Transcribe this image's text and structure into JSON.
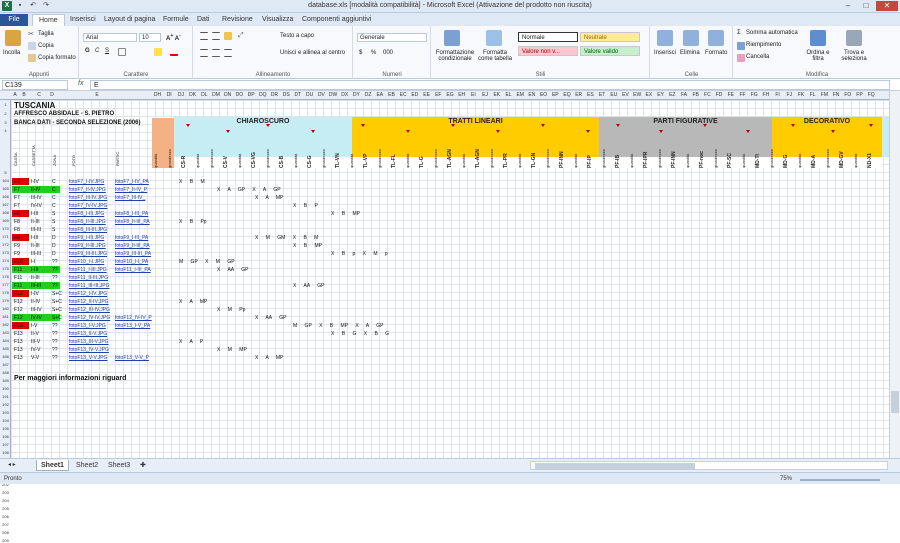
{
  "window": {
    "title": "database.xls [modalità compatibilità] - Microsoft Excel (Attivazione del prodotto non riuscita)",
    "excel_icon": "X"
  },
  "tabs": [
    "File",
    "Home",
    "Inserisci",
    "Layout di pagina",
    "Formule",
    "Dati",
    "Revisione",
    "Visualizza",
    "Componenti aggiuntivi"
  ],
  "ribbon": {
    "clipboard": {
      "paste": "Incolla",
      "cut": "Taglia",
      "copy": "Copia",
      "format_painter": "Copia formato",
      "label": "Appunti"
    },
    "font": {
      "name": "Arial",
      "size": "10",
      "label": "Carattere",
      "bold": "G",
      "italic": "C",
      "underline": "S"
    },
    "alignment": {
      "wrap": "Testo a capo",
      "merge": "Unisci e allinea al centro",
      "label": "Allineamento"
    },
    "number": {
      "format": "Generale",
      "label": "Numeri",
      "currency": "$",
      "percent": "%",
      "thousands": "000"
    },
    "styles": {
      "cond": "Formattazione condizionale",
      "table": "Formatta come tabella",
      "normal": "Normale",
      "neutral": "Neutrale",
      "bad": "Valore non v...",
      "good": "Valore valido",
      "label": "Stili"
    },
    "cells": {
      "insert": "Inserisci",
      "delete": "Elimina",
      "format": "Formato",
      "label": "Celle"
    },
    "editing": {
      "autosum": "Somma automatica",
      "fill": "Riempimento",
      "clear": "Cancella",
      "sort": "Ordina e filtra",
      "find": "Trova e seleziona",
      "label": "Modifica"
    }
  },
  "formula_bar": {
    "name_box": "C139",
    "fx": "fx",
    "value": "E"
  },
  "sheet": {
    "title": "TUSCANIA",
    "subtitle": "AFFRESCO ABSIDALE - S. PIETRO",
    "subtitle2": "BANCA DATI - SECONDA SELEZIONE (2006)",
    "col_titles": [
      "CASSA",
      "CASSETTA",
      "ZONA",
      "FOTO",
      "PARTIC."
    ],
    "sections": [
      "CHIAROSCURO",
      "TRATTI LINEARI",
      "PARTI FIGURATIVE",
      "DECORATIVO"
    ],
    "footer_note": "Per maggiori informazioni riguard",
    "rows": [
      {
        "n": "164",
        "cassa": "F7",
        "cas": "I-IV",
        "zona": "C",
        "foto": "fotoF7_I-IV.JPG",
        "partic": "fotoF7_I-IV_PA",
        "vals": "X B M",
        "fill": "#e00000"
      },
      {
        "n": "165",
        "cassa": "F7",
        "cas": "II-IV",
        "zona": "C",
        "foto": "fotoF7_II-IV.JPG",
        "partic": "fotoF7_II-IV_P",
        "vals": "X A GP X A GP",
        "fill": "#22cc22"
      },
      {
        "n": "166",
        "cassa": "F7",
        "cas": "III-IV",
        "zona": "C",
        "foto": "fotoF7_III-IV.JPG",
        "partic": "fotoF7_III-IV_",
        "vals": "X A MP",
        "fill": ""
      },
      {
        "n": "167",
        "cassa": "F7",
        "cas": "IV-IV",
        "zona": "C",
        "foto": "fotoF7_IV-IV.JPG",
        "partic": "",
        "vals": "X B P",
        "fill": ""
      },
      {
        "n": "168",
        "cassa": "F8",
        "cas": "I-III",
        "zona": "S",
        "foto": "fotoF8_I-III.JPG",
        "partic": "fotoF8_I-III_PA",
        "vals": "X B MP",
        "fill": "#e00000"
      },
      {
        "n": "169",
        "cassa": "F8",
        "cas": "II-III",
        "zona": "S",
        "foto": "fotoF8_II-III.JPG",
        "partic": "fotoF8_II-III_PA",
        "vals": "X B Pp",
        "fill": ""
      },
      {
        "n": "170",
        "cassa": "F8",
        "cas": "III-III",
        "zona": "S",
        "foto": "fotoF8_III-III.JPG",
        "partic": "",
        "vals": "",
        "fill": ""
      },
      {
        "n": "171",
        "cassa": "F9",
        "cas": "I-III",
        "zona": "D",
        "foto": "fotoF9_I-III.JPG",
        "partic": "fotoF9_I-III_PA",
        "vals": "X M GM X B M",
        "fill": "#e00000"
      },
      {
        "n": "172",
        "cassa": "F9",
        "cas": "II-III",
        "zona": "D",
        "foto": "fotoF9_II-III.JPG",
        "partic": "fotoF9_II-III_PA",
        "vals": "X B MP",
        "fill": ""
      },
      {
        "n": "173",
        "cassa": "F9",
        "cas": "III-III",
        "zona": "D",
        "foto": "fotoF9_III-III.JPG",
        "partic": "fotoF9_III-III_PA",
        "vals": "X B p X M p",
        "fill": ""
      },
      {
        "n": "174",
        "cassa": "F10",
        "cas": "I-I",
        "zona": "??",
        "foto": "fotoF10_I-I.JPG",
        "partic": "fotoF10_I-I_PA",
        "vals": "M GP X M GP",
        "fill": "#e00000"
      },
      {
        "n": "175",
        "cassa": "F11",
        "cas": "I-III",
        "zona": "??",
        "foto": "fotoF11_I-III.JPG",
        "partic": "fotoF11_I-III_PA",
        "vals": "X AA GP",
        "fill": "#22cc22"
      },
      {
        "n": "176",
        "cassa": "F11",
        "cas": "II-III",
        "zona": "??",
        "foto": "fotoF11_II-III.JPG",
        "partic": "",
        "vals": "",
        "fill": ""
      },
      {
        "n": "177",
        "cassa": "F11",
        "cas": "III-III",
        "zona": "??",
        "foto": "fotoF11_III-III.JPG",
        "partic": "",
        "vals": "X AA GP",
        "fill": "#22cc22"
      },
      {
        "n": "178",
        "cassa": "F12",
        "cas": "I-IV",
        "zona": "S+C",
        "foto": "fotoF12_I-IV.JPG",
        "partic": "",
        "vals": "",
        "fill": "#e00000"
      },
      {
        "n": "179",
        "cassa": "F12",
        "cas": "II-IV",
        "zona": "S+C",
        "foto": "fotoF12_II-IV.JPG",
        "partic": "",
        "vals": "X A MP",
        "fill": ""
      },
      {
        "n": "180",
        "cassa": "F12",
        "cas": "III-IV",
        "zona": "S+C",
        "foto": "fotoF12_III-IV.JPG",
        "partic": "",
        "vals": "X M Pp",
        "fill": ""
      },
      {
        "n": "181",
        "cassa": "F12",
        "cas": "IV-IV",
        "zona": "S+C",
        "foto": "fotoF12_IV-IV.JPG",
        "partic": "fotoF12_IV-IV_P",
        "vals": "X AA GP",
        "fill": "#22cc22"
      },
      {
        "n": "182",
        "cassa": "F13",
        "cas": "I-V",
        "zona": "??",
        "foto": "fotoF13_I-V.JPG",
        "partic": "fotoF13_I-V_PA",
        "vals": "M GP X B MP X A GP",
        "fill": "#e00000"
      },
      {
        "n": "183",
        "cassa": "F13",
        "cas": "II-V",
        "zona": "??",
        "foto": "fotoF13_II-V.JPG",
        "partic": "",
        "vals": "X B G X B G",
        "fill": ""
      },
      {
        "n": "184",
        "cassa": "F13",
        "cas": "III-V",
        "zona": "??",
        "foto": "fotoF13_III-V.JPG",
        "partic": "",
        "vals": "X A P",
        "fill": ""
      },
      {
        "n": "185",
        "cassa": "F13",
        "cas": "IV-V",
        "zona": "??",
        "foto": "fotoF13_IV-V.JPG",
        "partic": "",
        "vals": "X M MP",
        "fill": ""
      },
      {
        "n": "186",
        "cassa": "F13",
        "cas": "V-V",
        "zona": "??",
        "foto": "fotoF13_V-V.JPG",
        "partic": "fotoF13_V-V_P",
        "vals": "X A MP",
        "fill": ""
      }
    ]
  },
  "sheets": [
    "Sheet1",
    "Sheet2",
    "Sheet3"
  ],
  "status": {
    "left": "Pronto",
    "zoom": "75%"
  }
}
